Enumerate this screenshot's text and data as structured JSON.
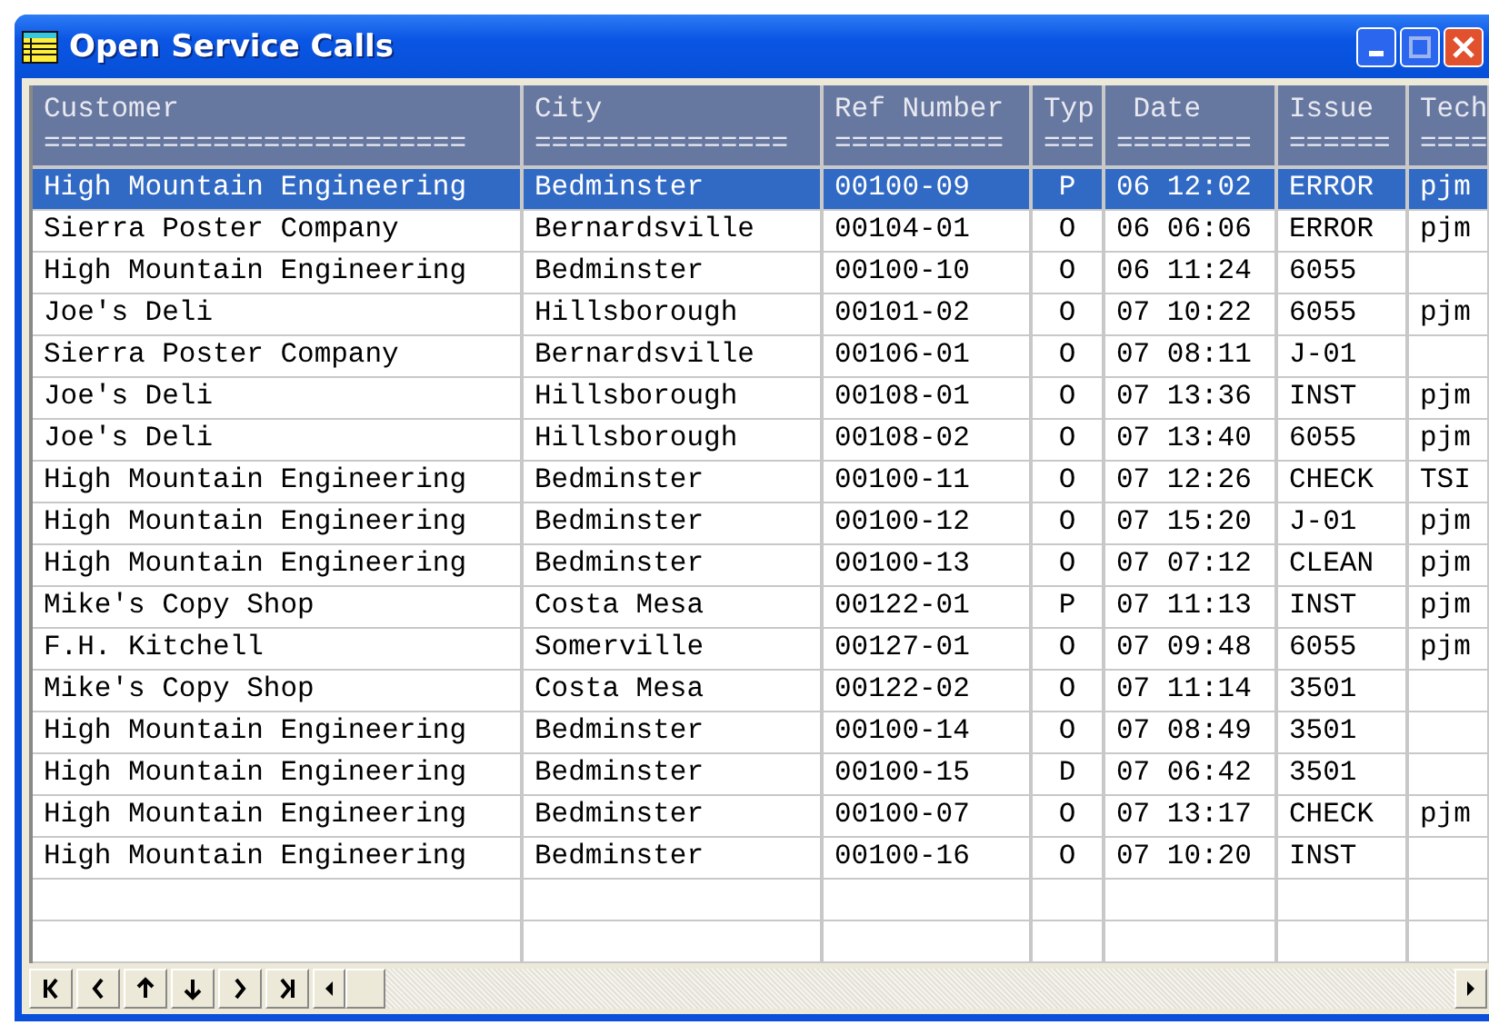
{
  "window": {
    "title": "Open Service Calls"
  },
  "table": {
    "columns": [
      {
        "label": "Customer",
        "rule": "========================="
      },
      {
        "label": "City",
        "rule": "==============="
      },
      {
        "label": "Ref Number",
        "rule": "=========="
      },
      {
        "label": "Typ",
        "rule": "==="
      },
      {
        "label": " Date",
        "rule": "========"
      },
      {
        "label": "Issue",
        "rule": "======"
      },
      {
        "label": "Tech",
        "rule": "===="
      }
    ],
    "rows": [
      {
        "selected": true,
        "customer": "High Mountain Engineering",
        "city": "Bedminster",
        "ref": "00100-09",
        "typ": "P",
        "date": "06 12:02",
        "issue": "ERROR",
        "tech": "pjm"
      },
      {
        "selected": false,
        "customer": "Sierra Poster Company",
        "city": "Bernardsville",
        "ref": "00104-01",
        "typ": "O",
        "date": "06 06:06",
        "issue": "ERROR",
        "tech": "pjm"
      },
      {
        "selected": false,
        "customer": "High Mountain Engineering",
        "city": "Bedminster",
        "ref": "00100-10",
        "typ": "O",
        "date": "06 11:24",
        "issue": "6055"
      },
      {
        "selected": false,
        "customer": "Joe's Deli",
        "city": "Hillsborough",
        "ref": "00101-02",
        "typ": "O",
        "date": "07 10:22",
        "issue": "6055",
        "tech": "pjm"
      },
      {
        "selected": false,
        "customer": "Sierra Poster Company",
        "city": "Bernardsville",
        "ref": "00106-01",
        "typ": "O",
        "date": "07 08:11",
        "issue": "J-01"
      },
      {
        "selected": false,
        "customer": "Joe's Deli",
        "city": "Hillsborough",
        "ref": "00108-01",
        "typ": "O",
        "date": "07 13:36",
        "issue": "INST",
        "tech": "pjm"
      },
      {
        "selected": false,
        "customer": "Joe's Deli",
        "city": "Hillsborough",
        "ref": "00108-02",
        "typ": "O",
        "date": "07 13:40",
        "issue": "6055",
        "tech": "pjm"
      },
      {
        "selected": false,
        "customer": "High Mountain Engineering",
        "city": "Bedminster",
        "ref": "00100-11",
        "typ": "O",
        "date": "07 12:26",
        "issue": "CHECK",
        "tech": "TSI"
      },
      {
        "selected": false,
        "customer": "High Mountain Engineering",
        "city": "Bedminster",
        "ref": "00100-12",
        "typ": "O",
        "date": "07 15:20",
        "issue": "J-01",
        "tech": "pjm"
      },
      {
        "selected": false,
        "customer": "High Mountain Engineering",
        "city": "Bedminster",
        "ref": "00100-13",
        "typ": "O",
        "date": "07 07:12",
        "issue": "CLEAN",
        "tech": "pjm"
      },
      {
        "selected": false,
        "customer": "Mike's Copy Shop",
        "city": "Costa Mesa",
        "ref": "00122-01",
        "typ": "P",
        "date": "07 11:13",
        "issue": "INST",
        "tech": "pjm"
      },
      {
        "selected": false,
        "customer": "F.H. Kitchell",
        "city": "Somerville",
        "ref": "00127-01",
        "typ": "O",
        "date": "07 09:48",
        "issue": "6055",
        "tech": "pjm"
      },
      {
        "selected": false,
        "customer": "Mike's Copy Shop",
        "city": "Costa Mesa",
        "ref": "00122-02",
        "typ": "O",
        "date": "07 11:14",
        "issue": "3501"
      },
      {
        "selected": false,
        "customer": "High Mountain Engineering",
        "city": "Bedminster",
        "ref": "00100-14",
        "typ": "O",
        "date": "07 08:49",
        "issue": "3501"
      },
      {
        "selected": false,
        "customer": "High Mountain Engineering",
        "city": "Bedminster",
        "ref": "00100-15",
        "typ": "D",
        "date": "07 06:42",
        "issue": "3501"
      },
      {
        "selected": false,
        "customer": "High Mountain Engineering",
        "city": "Bedminster",
        "ref": "00100-07",
        "typ": "O",
        "date": "07 13:17",
        "issue": "CHECK",
        "tech": "pjm"
      },
      {
        "selected": false,
        "customer": "High Mountain Engineering",
        "city": "Bedminster",
        "ref": "00100-16",
        "typ": "O",
        "date": "07 10:20",
        "issue": "INST"
      }
    ]
  },
  "navigator": {
    "buttons": [
      {
        "kind": "first"
      },
      {
        "kind": "prev"
      },
      {
        "kind": "up"
      },
      {
        "kind": "down"
      },
      {
        "kind": "next"
      },
      {
        "kind": "last"
      }
    ]
  }
}
